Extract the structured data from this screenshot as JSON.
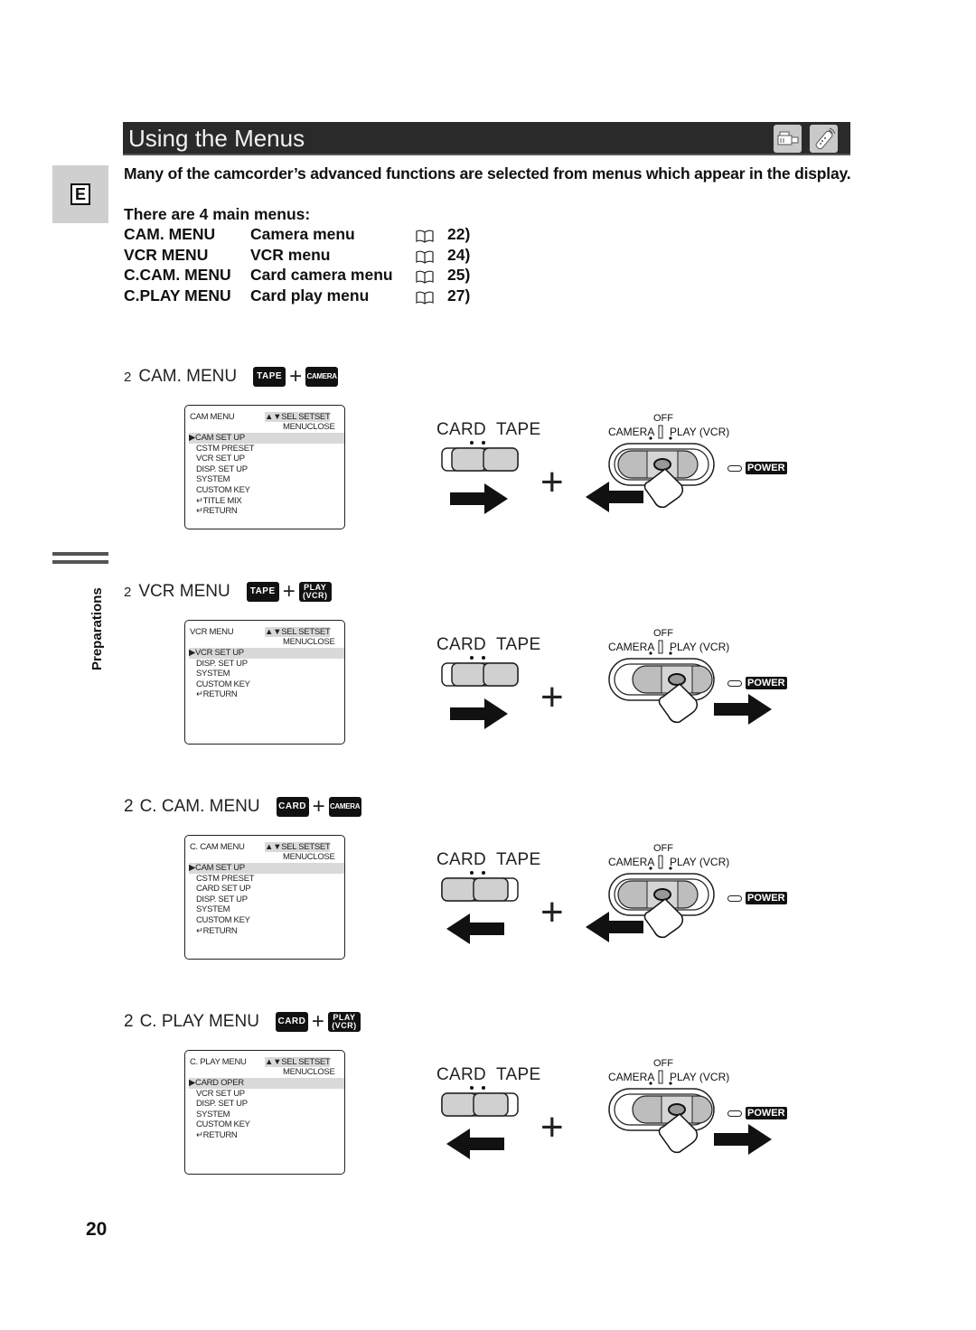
{
  "header": {
    "title": "Using the Menus",
    "icons": [
      "camcorder-icon",
      "remote-control-icon"
    ]
  },
  "language_tab": "E",
  "side_section": "Preparations",
  "intro": "Many of the camcorder’s advanced functions are selected from menus which appear in the display.",
  "main_menus": {
    "heading": "There are 4 main menus:",
    "rows": [
      {
        "name": "CAM. MENU",
        "description": "Camera menu",
        "page": "22)"
      },
      {
        "name": "VCR MENU",
        "description": "VCR menu",
        "page": "24)"
      },
      {
        "name": "C.CAM. MENU",
        "description": "Card camera menu",
        "page": "25)"
      },
      {
        "name": "C.PLAY MENU",
        "description": "Card play menu",
        "page": "27)"
      }
    ]
  },
  "sections": [
    {
      "step": "2",
      "title": "CAM. MENU",
      "badge1": "TAPE",
      "badge2": "CAMERA",
      "badge2_line2": "",
      "screen": {
        "title": "CAM MENU",
        "nav1": "▲▼SEL SETSET",
        "nav2": "MENUCLOSE",
        "items": [
          "▶CAM SET UP",
          "CSTM PRESET",
          "VCR SET UP",
          "DISP. SET UP",
          "SYSTEM",
          "CUSTOM KEY",
          "↵TITLE MIX",
          "↵RETURN"
        ]
      },
      "diagram": {
        "switch_position": "TAPE",
        "switch_arrow": "right",
        "dial_position": "CAMERA",
        "dial_arrow": "left"
      }
    },
    {
      "step": "2",
      "title": "VCR MENU",
      "badge1": "TAPE",
      "badge2": "PLAY",
      "badge2_line2": "(VCR)",
      "screen": {
        "title": "VCR MENU",
        "nav1": "▲▼SEL SETSET",
        "nav2": "MENUCLOSE",
        "items": [
          "▶VCR SET UP",
          "DISP. SET UP",
          "SYSTEM",
          "CUSTOM KEY",
          "↵RETURN"
        ]
      },
      "diagram": {
        "switch_position": "TAPE",
        "switch_arrow": "right",
        "dial_position": "PLAY (VCR)",
        "dial_arrow": "right"
      }
    },
    {
      "step": "2",
      "title": "C. CAM. MENU",
      "badge1": "CARD",
      "badge2": "CAMERA",
      "badge2_line2": "",
      "screen": {
        "title": "C.  CAM MENU",
        "nav1": "▲▼SEL SETSET",
        "nav2": "MENUCLOSE",
        "items": [
          "▶CAM SET UP",
          "CSTM PRESET",
          "CARD SET UP",
          "DISP. SET UP",
          "SYSTEM",
          "CUSTOM KEY",
          "↵RETURN"
        ]
      },
      "diagram": {
        "switch_position": "CARD",
        "switch_arrow": "left",
        "dial_position": "CAMERA",
        "dial_arrow": "left"
      }
    },
    {
      "step": "2",
      "title": "C. PLAY MENU",
      "badge1": "CARD",
      "badge2": "PLAY",
      "badge2_line2": "(VCR)",
      "screen": {
        "title": "C.  PLAY MENU",
        "nav1": "▲▼SEL SETSET",
        "nav2": "MENUCLOSE",
        "items": [
          "▶CARD OPER",
          "VCR SET UP",
          "DISP. SET UP",
          "SYSTEM",
          "CUSTOM KEY",
          "↵RETURN"
        ]
      },
      "diagram": {
        "switch_position": "CARD",
        "switch_arrow": "left",
        "dial_position": "PLAY (VCR)",
        "dial_arrow": "right"
      }
    }
  ],
  "diagram_labels": {
    "card": "CARD",
    "tape": "TAPE",
    "off": "OFF",
    "camera": "CAMERA",
    "play_vcr": "PLAY (VCR)",
    "power": "POWER",
    "plus": "+"
  },
  "page_number": "20"
}
